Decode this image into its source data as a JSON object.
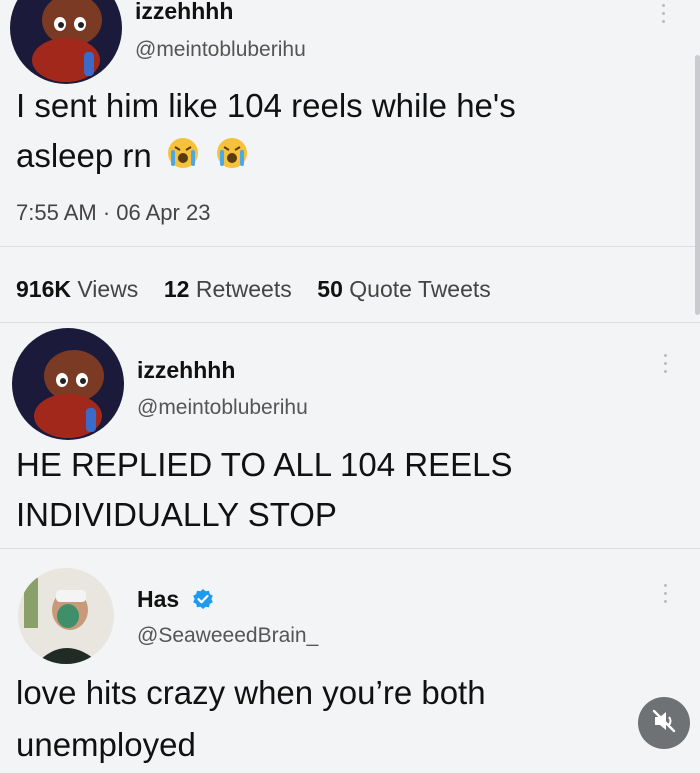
{
  "tweets": [
    {
      "name": "izzehhhh",
      "handle": "@meintobluberihu",
      "text_line1": "I sent him like 104 reels while he's",
      "text_line2": "asleep rn",
      "time": "7:55 AM · 06 Apr 23",
      "stats": {
        "views_count": "916K",
        "views_label": "Views",
        "retweets_count": "12",
        "retweets_label": "Retweets",
        "quotes_count": "50",
        "quotes_label": "Quote Tweets"
      }
    },
    {
      "name": "izzehhhh",
      "handle": "@meintobluberihu",
      "text_line1": "HE REPLIED TO ALL 104 REELS",
      "text_line2": "INDIVIDUALLY STOP"
    },
    {
      "name": "Has",
      "handle": "@SeaweeedBrain_",
      "verified": true,
      "text_line1": "love hits crazy when you’re both",
      "text_line2": "unemployed"
    }
  ],
  "icons": {
    "more": "more-vertical-icon",
    "emoji": "loudly-crying-face-emoji",
    "verified": "verified-badge-icon",
    "mute": "speaker-muted-icon"
  },
  "colors": {
    "background": "#f3f4f5",
    "verified_blue": "#1d9bf0",
    "mute_button": "#6f7275"
  }
}
